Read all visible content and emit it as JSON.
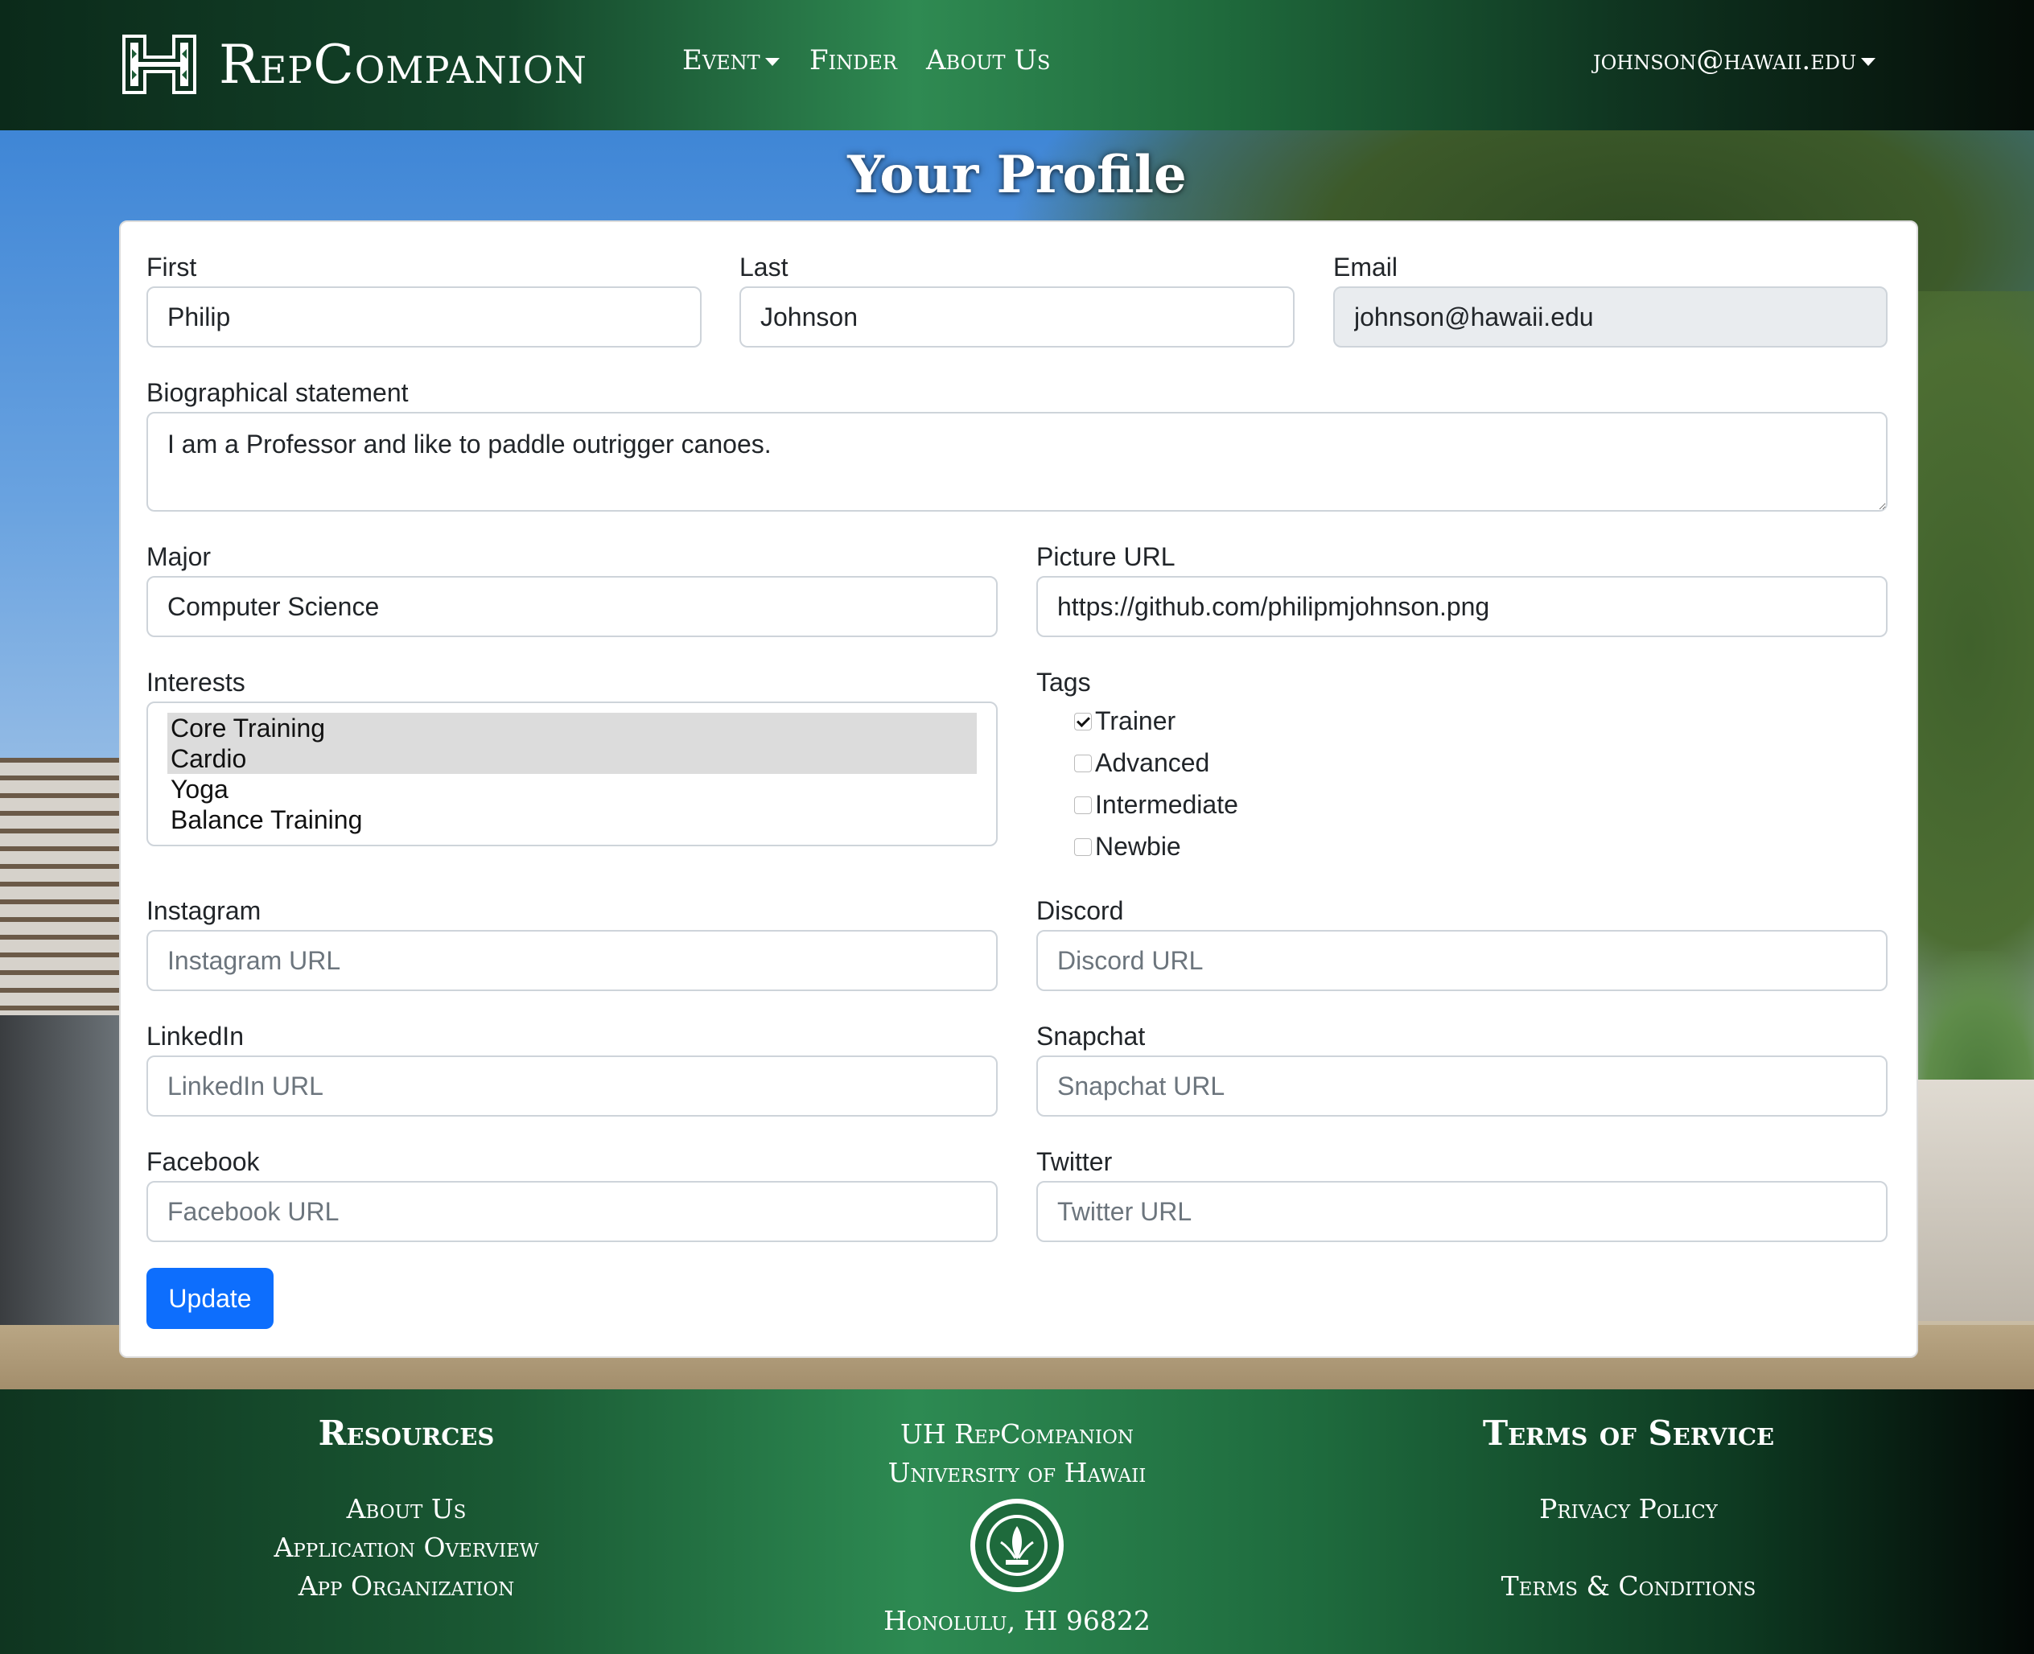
{
  "navbar": {
    "brand": "RepCompanion",
    "event": "Event",
    "finder": "Finder",
    "about": "About Us",
    "user": "johnson@hawaii.edu"
  },
  "page": {
    "title": "Your Profile"
  },
  "form": {
    "first_label": "First",
    "first_value": "Philip",
    "last_label": "Last",
    "last_value": "Johnson",
    "email_label": "Email",
    "email_value": "johnson@hawaii.edu",
    "bio_label": "Biographical statement",
    "bio_value": "I am a Professor and like to paddle outrigger canoes.",
    "major_label": "Major",
    "major_value": "Computer Science",
    "picture_label": "Picture URL",
    "picture_value": "https://github.com/philipmjohnson.png",
    "interests_label": "Interests",
    "interests": [
      {
        "label": "Core Training",
        "selected": true
      },
      {
        "label": "Cardio",
        "selected": true
      },
      {
        "label": "Yoga",
        "selected": false
      },
      {
        "label": "Balance Training",
        "selected": false
      }
    ],
    "tags_label": "Tags",
    "tags": [
      {
        "label": "Trainer",
        "checked": true
      },
      {
        "label": "Advanced",
        "checked": false
      },
      {
        "label": "Intermediate",
        "checked": false
      },
      {
        "label": "Newbie",
        "checked": false
      }
    ],
    "instagram_label": "Instagram",
    "instagram_placeholder": "Instagram URL",
    "discord_label": "Discord",
    "discord_placeholder": "Discord URL",
    "linkedin_label": "LinkedIn",
    "linkedin_placeholder": "LinkedIn URL",
    "snapchat_label": "Snapchat",
    "snapchat_placeholder": "Snapchat URL",
    "facebook_label": "Facebook",
    "facebook_placeholder": "Facebook URL",
    "twitter_label": "Twitter",
    "twitter_placeholder": "Twitter URL",
    "update_label": "Update"
  },
  "footer": {
    "resources_title": "Resources",
    "resources": [
      "About Us",
      "Application Overview",
      "App Organization"
    ],
    "center_line1": "UH RepCompanion",
    "center_line2": "University of Hawaii",
    "center_address": "Honolulu, HI 96822",
    "terms_title": "Terms of Service",
    "privacy": "Privacy Policy",
    "conditions": "Terms & Conditions"
  },
  "colors": {
    "primary": "#0d6efd",
    "uh_green": "#1e6a3c"
  },
  "icons": {
    "logo": "uh-h-logo-icon",
    "seal": "uh-seal-icon",
    "caret": "caret-down-icon",
    "check": "check-icon"
  }
}
